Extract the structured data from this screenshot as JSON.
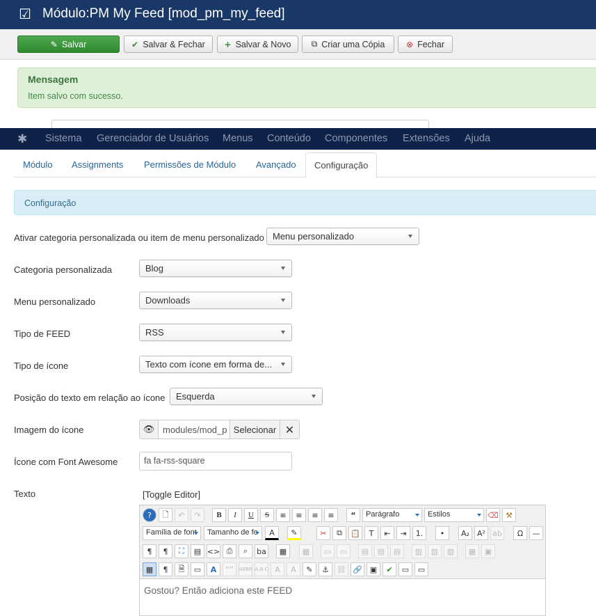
{
  "header": {
    "title": "Módulo:PM My Feed [mod_pm_my_feed]"
  },
  "toolbar": {
    "save": "Salvar",
    "save_close": "Salvar & Fechar",
    "save_new": "Salvar & Novo",
    "copy": "Criar uma Cópia",
    "close": "Fechar"
  },
  "message": {
    "heading": "Mensagem",
    "body": "Item salvo com sucesso."
  },
  "nav": {
    "items": [
      "Sistema",
      "Gerenciador de Usuários",
      "Menus",
      "Conteúdo",
      "Componentes",
      "Extensões",
      "Ajuda"
    ]
  },
  "tabs": [
    "Módulo",
    "Assignments",
    "Permissões de Módulo",
    "Avançado",
    "Configuração"
  ],
  "config_heading": "Configuração",
  "fields": {
    "activate": {
      "label": "Ativar categoria personalizada ou item de menu personalizado",
      "value": "Menu personalizado"
    },
    "category": {
      "label": "Categoria personalizada",
      "value": "Blog"
    },
    "menu": {
      "label": "Menu personalizado",
      "value": "Downloads"
    },
    "feed_type": {
      "label": "Tipo de FEED",
      "value": "RSS"
    },
    "icon_type": {
      "label": "Tipo de ícone",
      "value": "Texto com ícone em forma de..."
    },
    "text_pos": {
      "label": "Posição do texto em relação ao ícone",
      "value": "Esquerda"
    },
    "icon_image": {
      "label": "Imagem do ícone",
      "value": "modules/mod_p",
      "select": "Selecionar"
    },
    "fa_icon": {
      "label": "Ícone com Font Awesome",
      "value": "fa fa-rss-square"
    },
    "text": {
      "label": "Texto",
      "toggle": "[Toggle Editor]",
      "content": "Gostou? Então adiciona este FEED"
    }
  },
  "editor": {
    "format": "Parágrafo",
    "styles": "Estilos",
    "font_family": "Família de font",
    "font_size": "Tamanho de fo"
  }
}
